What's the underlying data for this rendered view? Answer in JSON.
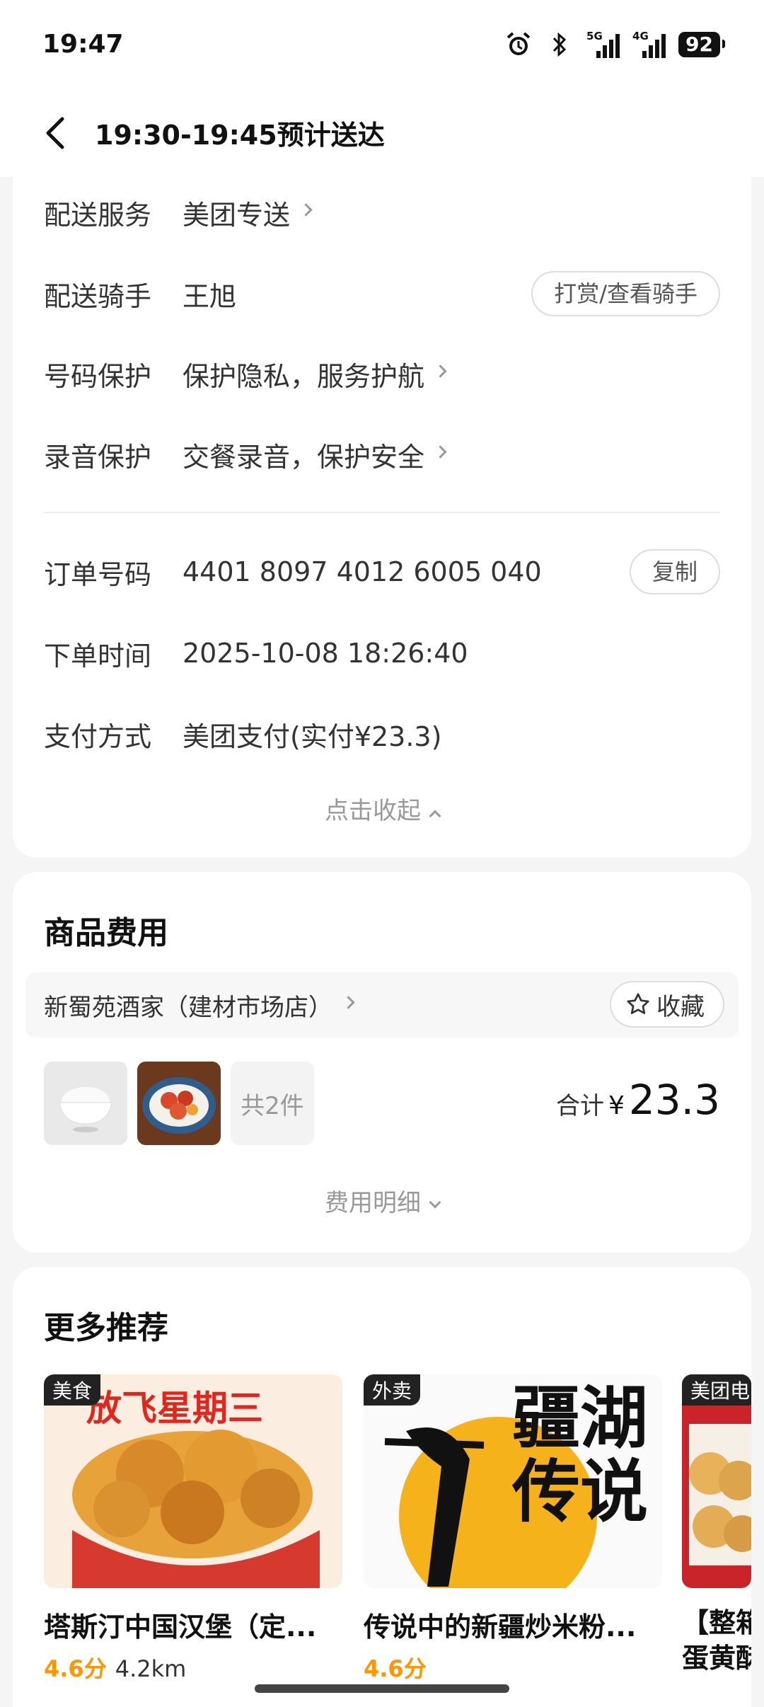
{
  "status_bar": {
    "time": "19:47",
    "battery": "92",
    "net1": "5G",
    "net2": "4G"
  },
  "nav": {
    "title": "19:30-19:45预计送达"
  },
  "delivery": {
    "rows": [
      {
        "label": "配送服务",
        "value": "美团专送"
      },
      {
        "label": "配送骑手",
        "value": "王旭",
        "action": "打赏/查看骑手"
      },
      {
        "label": "号码保护",
        "value": "保护隐私，服务护航"
      },
      {
        "label": "录音保护",
        "value": "交餐录音，保护安全"
      }
    ],
    "order": [
      {
        "label": "订单号码",
        "value": "4401 8097 4012 6005 040",
        "action": "复制"
      },
      {
        "label": "下单时间",
        "value": "2025-10-08 18:26:40"
      },
      {
        "label": "支付方式",
        "value": "美团支付(实付¥23.3)"
      }
    ],
    "collapse_label": "点击收起"
  },
  "goods": {
    "title": "商品费用",
    "store": "新蜀苑酒家（建材市场店）",
    "favorite_label": "收藏",
    "count_label": "共2件",
    "total_label": "合计",
    "currency": "¥",
    "total_amount": "23.3",
    "detail_label": "费用明细"
  },
  "recommend": {
    "title": "更多推荐",
    "items": [
      {
        "tag": "美食",
        "name": "塔斯汀中国汉堡（定...",
        "score": "4.6分",
        "distance": "4.2km",
        "banner": "放飞星期三"
      },
      {
        "tag": "外卖",
        "name": "传说中的新疆炒米粉...",
        "score": "4.6分",
        "distance": "",
        "banner": "疆湖传说"
      },
      {
        "tag": "美团电",
        "name": "【整箱",
        "name2": "蛋黄酥",
        "score": "",
        "distance": ""
      }
    ]
  }
}
